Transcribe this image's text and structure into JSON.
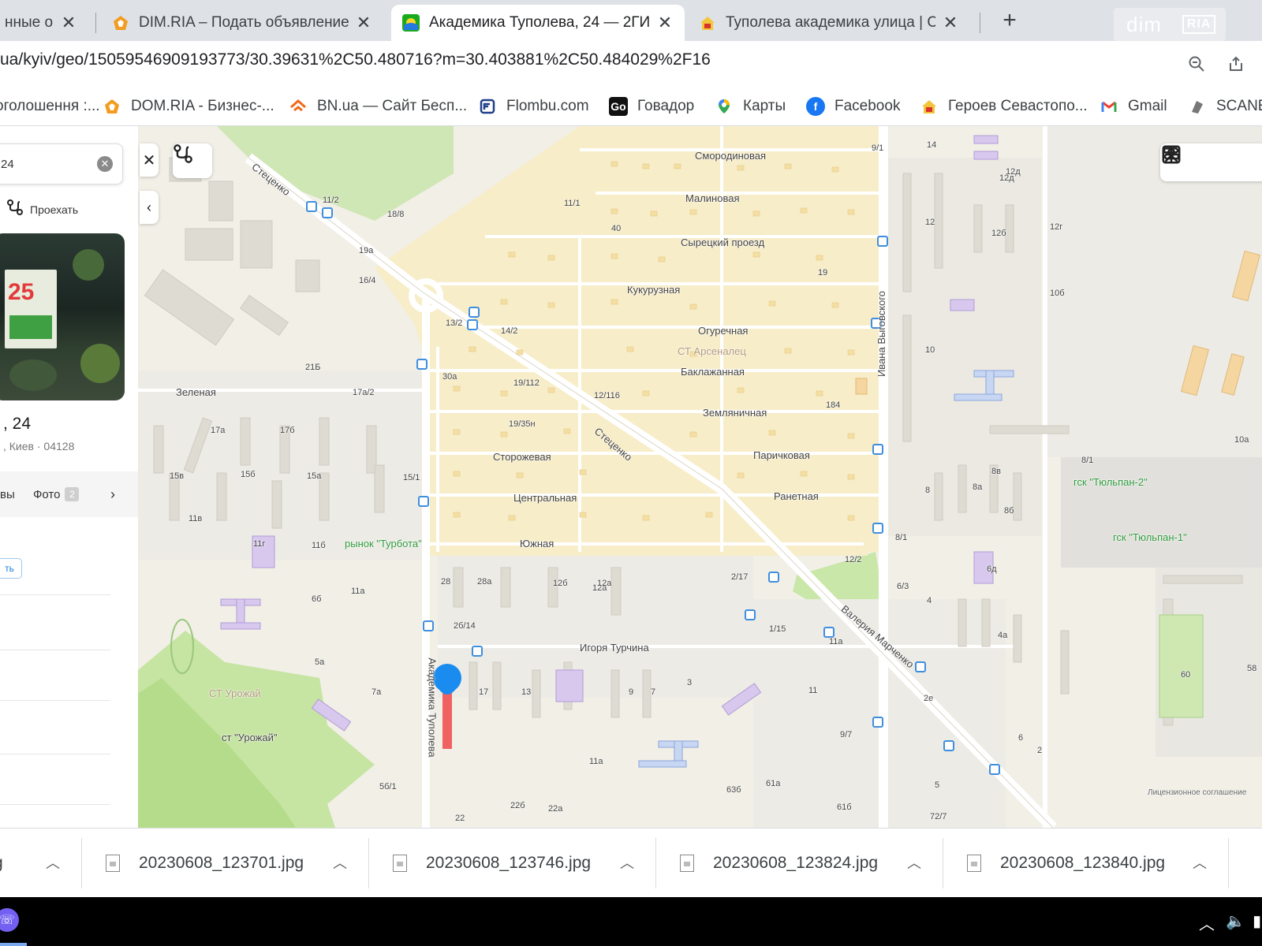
{
  "tabs": [
    {
      "title": "нные объ",
      "favicon": "doc-icon",
      "active": false
    },
    {
      "title": "DIM.RIA – Подать объявление о",
      "favicon": "domria-icon",
      "active": false
    },
    {
      "title": "Академика Туполева, 24 — 2ГИ",
      "favicon": "2gis-icon",
      "active": true
    },
    {
      "title": "Туполева академика улица | Св",
      "favicon": "dimria-house-icon",
      "active": false
    }
  ],
  "new_tab_label": "+",
  "brand": {
    "left": "dim",
    "right": "RIA"
  },
  "address_bar": {
    "url": "ua/kyiv/geo/15059546909193773/30.39631%2C50.480716?m=30.403881%2C50.484029%2F16"
  },
  "bookmarks": [
    {
      "label": "оголошення :...",
      "icon": "none"
    },
    {
      "label": "DOM.RIA - Бизнес-...",
      "icon": "domria-icon"
    },
    {
      "label": "BN.ua — Сайт Бесп...",
      "icon": "bn-icon"
    },
    {
      "label": "Flombu.com",
      "icon": "flombu-icon"
    },
    {
      "label": "Говадор",
      "icon": "go-icon"
    },
    {
      "label": "Карты",
      "icon": "maps-pin-icon"
    },
    {
      "label": "Facebook",
      "icon": "facebook-icon"
    },
    {
      "label": "Героев Севастопо...",
      "icon": "dimria-house-icon"
    },
    {
      "label": "Gmail",
      "icon": "gmail-icon"
    },
    {
      "label": "SCANE",
      "icon": "scan-icon"
    }
  ],
  "panel": {
    "search_value": "24",
    "route_label": "Проехать",
    "photo_price_text": "25",
    "address_title": ", 24",
    "address_sub": ", Киев · 04128",
    "tab_reviews": "вы",
    "tab_photo": "Фото",
    "photo_count": "2",
    "small_btn": "ть"
  },
  "map": {
    "streets": [
      "Смородиновая",
      "Малиновая",
      "Сырецкий проезд",
      "Кукурузная",
      "Огуречная",
      "СТ Арсеналец",
      "Баклажанная",
      "Земляничная",
      "Стеценко",
      "Паричковая",
      "Ранетная",
      "Сторожевая",
      "Центральная",
      "Южная",
      "Зеленая",
      "Игоря Турчина",
      "Академика Туполева",
      "Ивана Выговского",
      "Валерия Марченко",
      "Стеценко",
      "СТ Урожай",
      "ст \"Урожай\"",
      "рынок \"Турбота\"",
      "гск \"Тюльпан-2\"",
      "гск \"Тюльпан-1\"",
      "Лицензионное соглашение"
    ],
    "house_numbers": [
      "11/1",
      "40",
      "19",
      "21Б",
      "11/2",
      "18/8",
      "19а",
      "16/4",
      "13/2",
      "14/2",
      "12/116",
      "19/112",
      "30а",
      "19/35н",
      "17а/2",
      "17а",
      "17б",
      "15/1",
      "15б",
      "15а",
      "15в",
      "11а",
      "11б",
      "11в",
      "11г",
      "6б",
      "5а",
      "7а",
      "5б/1",
      "13",
      "17",
      "9",
      "7",
      "11а",
      "2/17",
      "1/15",
      "11а",
      "3",
      "9/7",
      "11",
      "12/2",
      "6/3",
      "4",
      "14",
      "12",
      "12б",
      "12г",
      "12д",
      "10",
      "10б",
      "8",
      "8а",
      "8б",
      "8в",
      "8/1",
      "8/1",
      "6д",
      "4а",
      "2",
      "60",
      "58",
      "61а",
      "63б",
      "61б",
      "22б",
      "22а",
      "22",
      "72/7",
      "5",
      "12д",
      "12а",
      "2е",
      "6",
      "28",
      "28а",
      "12б",
      "12а",
      "2б/14",
      "184",
      "9/1",
      "10а"
    ]
  },
  "downloads": [
    {
      "name": "g"
    },
    {
      "name": "20230608_123701.jpg"
    },
    {
      "name": "20230608_123746.jpg"
    },
    {
      "name": "20230608_123824.jpg"
    },
    {
      "name": "20230608_123840.jpg"
    }
  ],
  "colors": {
    "tabbar": "#dee1e6",
    "map_bg": "#f1efe6",
    "map_garden": "#f7edc8",
    "map_green": "#c8e6a6",
    "pin_blue": "#1a8cf0",
    "pin_red": "#f06262",
    "transit_blue": "#3f8ede"
  }
}
